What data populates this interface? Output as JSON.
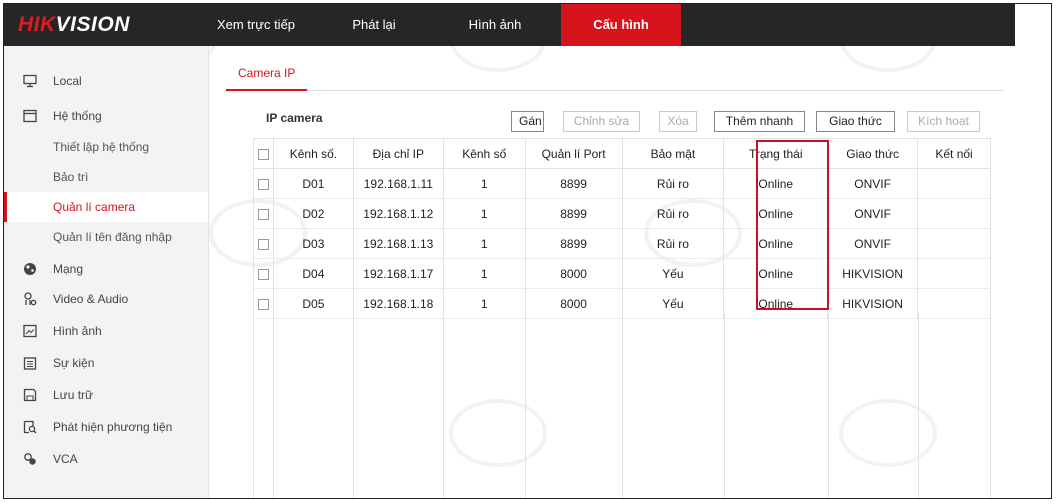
{
  "header": {
    "logo_red": "HIK",
    "logo_white": "VISION",
    "nav": [
      {
        "label": "Xem trực tiếp",
        "active": false
      },
      {
        "label": "Phát lại",
        "active": false
      },
      {
        "label": "Hình ảnh",
        "active": false
      },
      {
        "label": "Cấu hình",
        "active": true
      }
    ]
  },
  "sidebar": {
    "items": [
      {
        "label": "Local",
        "icon": "monitor-icon",
        "sub": false,
        "active": false
      },
      {
        "label": "Hệ thống",
        "icon": "system-icon",
        "sub": false,
        "active": false
      },
      {
        "label": "Thiết lập hệ thống",
        "icon": "",
        "sub": true,
        "active": false
      },
      {
        "label": "Bảo trì",
        "icon": "",
        "sub": true,
        "active": false
      },
      {
        "label": "Quản lí camera",
        "icon": "",
        "sub": true,
        "active": true
      },
      {
        "label": "Quản lí tên đăng nhập",
        "icon": "",
        "sub": true,
        "active": false
      },
      {
        "label": "Mạng",
        "icon": "network-icon",
        "sub": false,
        "active": false
      },
      {
        "label": "Video & Audio",
        "icon": "video-audio-icon",
        "sub": false,
        "active": false
      },
      {
        "label": "Hình ảnh",
        "icon": "image-icon",
        "sub": false,
        "active": false
      },
      {
        "label": "Sự kiện",
        "icon": "event-icon",
        "sub": false,
        "active": false
      },
      {
        "label": "Lưu trữ",
        "icon": "storage-icon",
        "sub": false,
        "active": false
      },
      {
        "label": "Phát hiện phương tiện",
        "icon": "vehicle-detection-icon",
        "sub": false,
        "active": false
      },
      {
        "label": "VCA",
        "icon": "vca-icon",
        "sub": false,
        "active": false
      }
    ]
  },
  "main": {
    "tab": "Camera IP",
    "panel_title": "IP camera",
    "buttons": [
      {
        "label": "Gán",
        "enabled": true
      },
      {
        "label": "Chỉnh sửa",
        "enabled": false
      },
      {
        "label": "Xóa",
        "enabled": false
      },
      {
        "label": "Thêm nhanh",
        "enabled": true
      },
      {
        "label": "Giao thức",
        "enabled": true
      },
      {
        "label": "Kích hoạt",
        "enabled": false
      }
    ],
    "columns": [
      "Kênh số.",
      "Địa chỉ IP",
      "Kênh số",
      "Quản lí Port",
      "Bảo mật",
      "Trạng thái",
      "Giao thức",
      "Kết nối"
    ],
    "rows": [
      [
        "D01",
        "192.168.1.11",
        "1",
        "8899",
        "Rủi ro",
        "Online",
        "ONVIF",
        ""
      ],
      [
        "D02",
        "192.168.1.12",
        "1",
        "8899",
        "Rủi ro",
        "Online",
        "ONVIF",
        ""
      ],
      [
        "D03",
        "192.168.1.13",
        "1",
        "8899",
        "Rủi ro",
        "Online",
        "ONVIF",
        ""
      ],
      [
        "D04",
        "192.168.1.17",
        "1",
        "8000",
        "Yếu",
        "Online",
        "HIKVISION",
        ""
      ],
      [
        "D05",
        "192.168.1.18",
        "1",
        "8000",
        "Yếu",
        "Online",
        "HIKVISION",
        ""
      ]
    ]
  },
  "colors": {
    "accent": "#d7141c",
    "topbar": "#262626",
    "highlight": "#c8102e"
  }
}
